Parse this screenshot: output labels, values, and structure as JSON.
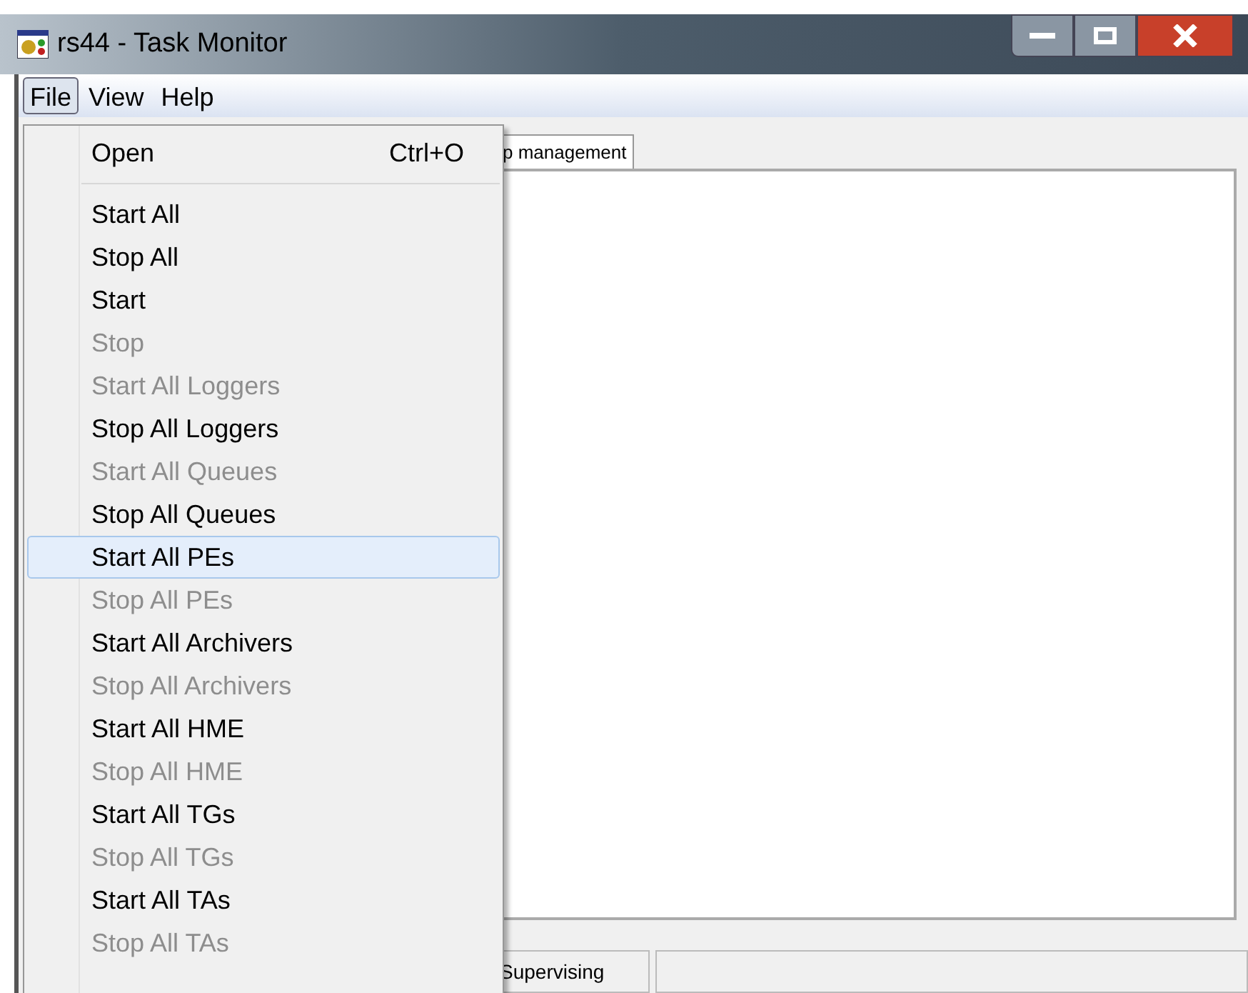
{
  "window": {
    "title": "rs44 - Task Monitor"
  },
  "menu_bar": [
    {
      "label": "File",
      "selected": true
    },
    {
      "label": "View",
      "selected": false
    },
    {
      "label": "Help",
      "selected": false
    }
  ],
  "tab": {
    "label": "p management"
  },
  "file_menu": [
    {
      "label": "Open",
      "shortcut": "Ctrl+O",
      "disabled": false,
      "selected": false,
      "separator_after": true
    },
    {
      "label": "Start All",
      "disabled": false,
      "selected": false
    },
    {
      "label": "Stop All",
      "disabled": false,
      "selected": false
    },
    {
      "label": "Start",
      "disabled": false,
      "selected": false
    },
    {
      "label": "Stop",
      "disabled": true,
      "selected": false
    },
    {
      "label": "Start All Loggers",
      "disabled": true,
      "selected": false
    },
    {
      "label": "Stop All Loggers",
      "disabled": false,
      "selected": false
    },
    {
      "label": "Start All Queues",
      "disabled": true,
      "selected": false
    },
    {
      "label": "Stop All Queues",
      "disabled": false,
      "selected": false
    },
    {
      "label": "Start All PEs",
      "disabled": false,
      "selected": true
    },
    {
      "label": "Stop All PEs",
      "disabled": true,
      "selected": false
    },
    {
      "label": "Start All Archivers",
      "disabled": false,
      "selected": false
    },
    {
      "label": "Stop All Archivers",
      "disabled": true,
      "selected": false
    },
    {
      "label": "Start All HME",
      "disabled": false,
      "selected": false
    },
    {
      "label": "Stop All HME",
      "disabled": true,
      "selected": false
    },
    {
      "label": "Start All TGs",
      "disabled": false,
      "selected": false
    },
    {
      "label": "Stop All TGs",
      "disabled": true,
      "selected": false
    },
    {
      "label": "Start All TAs",
      "disabled": false,
      "selected": false
    },
    {
      "label": "Stop All TAs",
      "disabled": true,
      "selected": false
    }
  ],
  "status_bar": [
    {
      "text": "Supervising"
    }
  ]
}
